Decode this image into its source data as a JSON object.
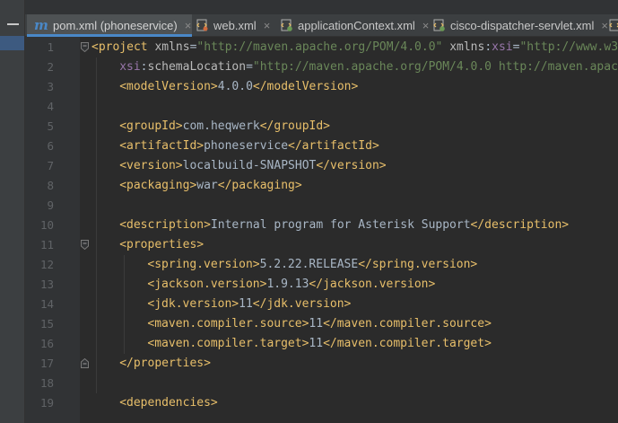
{
  "tabs": [
    {
      "label": "pom.xml (phoneservice)",
      "icon": "maven-icon",
      "active": true
    },
    {
      "label": "web.xml",
      "icon": "xml-file-icon",
      "active": false
    },
    {
      "label": "applicationContext.xml",
      "icon": "spring-xml-icon",
      "active": false
    },
    {
      "label": "cisco-dispatcher-servlet.xml",
      "icon": "spring-xml-icon",
      "active": false
    }
  ],
  "close_glyph": "×",
  "colors": {
    "tag": "#e8bf6a",
    "attr": "#bababa",
    "ns": "#9876aa",
    "string": "#6a8759",
    "text": "#a9b7c6",
    "accent": "#4a88c7"
  },
  "lines": [
    {
      "n": "1",
      "indent": 0,
      "fold": "open",
      "segs": [
        [
          "t",
          "<project "
        ],
        [
          "a",
          "xmlns"
        ],
        [
          "p",
          "="
        ],
        [
          "s",
          "\"http://maven.apache.org/POM/4.0.0\""
        ],
        [
          "p",
          " "
        ],
        [
          "a",
          "xmlns"
        ],
        [
          "p",
          ":"
        ],
        [
          "ns",
          "xsi"
        ],
        [
          "p",
          "="
        ],
        [
          "s",
          "\"http://www.w3"
        ]
      ]
    },
    {
      "n": "2",
      "indent": 1,
      "fold": "",
      "segs": [
        [
          "ns",
          "xsi"
        ],
        [
          "p",
          ":"
        ],
        [
          "a",
          "schemaLocation"
        ],
        [
          "p",
          "="
        ],
        [
          "s",
          "\"http://maven.apache.org/POM/4.0.0 http://maven.apach"
        ]
      ]
    },
    {
      "n": "3",
      "indent": 1,
      "fold": "",
      "segs": [
        [
          "t",
          "<modelVersion>"
        ],
        [
          "p",
          "4.0.0"
        ],
        [
          "t",
          "</modelVersion>"
        ]
      ]
    },
    {
      "n": "4",
      "indent": 0,
      "fold": "",
      "segs": []
    },
    {
      "n": "5",
      "indent": 1,
      "fold": "",
      "segs": [
        [
          "t",
          "<groupId>"
        ],
        [
          "p",
          "com.heqwerk"
        ],
        [
          "t",
          "</groupId>"
        ]
      ]
    },
    {
      "n": "6",
      "indent": 1,
      "fold": "",
      "segs": [
        [
          "t",
          "<artifactId>"
        ],
        [
          "p",
          "phoneservice"
        ],
        [
          "t",
          "</artifactId>"
        ]
      ]
    },
    {
      "n": "7",
      "indent": 1,
      "fold": "",
      "segs": [
        [
          "t",
          "<version>"
        ],
        [
          "p",
          "localbuild-SNAPSHOT"
        ],
        [
          "t",
          "</version>"
        ]
      ]
    },
    {
      "n": "8",
      "indent": 1,
      "fold": "",
      "segs": [
        [
          "t",
          "<packaging>"
        ],
        [
          "p",
          "war"
        ],
        [
          "t",
          "</packaging>"
        ]
      ]
    },
    {
      "n": "9",
      "indent": 0,
      "fold": "",
      "segs": []
    },
    {
      "n": "10",
      "indent": 1,
      "fold": "",
      "segs": [
        [
          "t",
          "<description>"
        ],
        [
          "p",
          "Internal program for Asterisk Support"
        ],
        [
          "t",
          "</description>"
        ]
      ]
    },
    {
      "n": "11",
      "indent": 1,
      "fold": "open",
      "segs": [
        [
          "t",
          "<properties>"
        ]
      ]
    },
    {
      "n": "12",
      "indent": 2,
      "fold": "",
      "segs": [
        [
          "t",
          "<spring.version>"
        ],
        [
          "p",
          "5.2.22.RELEASE"
        ],
        [
          "t",
          "</spring.version>"
        ]
      ]
    },
    {
      "n": "13",
      "indent": 2,
      "fold": "",
      "segs": [
        [
          "t",
          "<jackson.version>"
        ],
        [
          "p",
          "1.9.13"
        ],
        [
          "t",
          "</jackson.version>"
        ]
      ]
    },
    {
      "n": "14",
      "indent": 2,
      "fold": "",
      "segs": [
        [
          "t",
          "<jdk.version>"
        ],
        [
          "p",
          "11"
        ],
        [
          "t",
          "</jdk.version>"
        ]
      ]
    },
    {
      "n": "15",
      "indent": 2,
      "fold": "",
      "segs": [
        [
          "t",
          "<maven.compiler.source>"
        ],
        [
          "p",
          "11"
        ],
        [
          "t",
          "</maven.compiler.source>"
        ]
      ]
    },
    {
      "n": "16",
      "indent": 2,
      "fold": "",
      "segs": [
        [
          "t",
          "<maven.compiler.target>"
        ],
        [
          "p",
          "11"
        ],
        [
          "t",
          "</maven.compiler.target>"
        ]
      ]
    },
    {
      "n": "17",
      "indent": 1,
      "fold": "close",
      "segs": [
        [
          "t",
          "</properties>"
        ]
      ]
    },
    {
      "n": "18",
      "indent": 0,
      "fold": "",
      "segs": []
    },
    {
      "n": "19",
      "indent": 1,
      "fold": "",
      "segs": [
        [
          "t",
          "<dependencies>"
        ]
      ]
    }
  ]
}
